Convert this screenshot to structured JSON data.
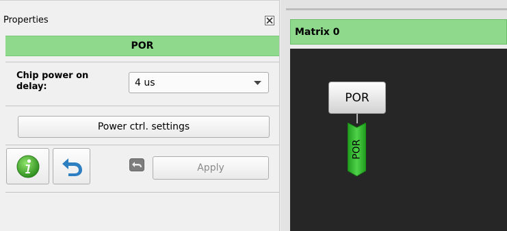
{
  "properties_panel": {
    "title": "Properties",
    "header": "POR",
    "chip_power_delay": {
      "label": "Chip power on delay:",
      "value": "4 us"
    },
    "power_settings_button": "Power ctrl. settings",
    "apply_button": "Apply"
  },
  "matrix": {
    "title": "Matrix 0",
    "block_label": "POR",
    "pin_label": "POR"
  },
  "icons": [
    "close-icon",
    "chevron-down-icon",
    "info-icon",
    "undo-icon",
    "reset-icon"
  ],
  "colors": {
    "header_green": "#8ed98c",
    "canvas_dark": "#262626",
    "pin_green": "#2fb82c",
    "info_green": "#3a9a2a",
    "undo_blue": "#2e7fc2"
  }
}
